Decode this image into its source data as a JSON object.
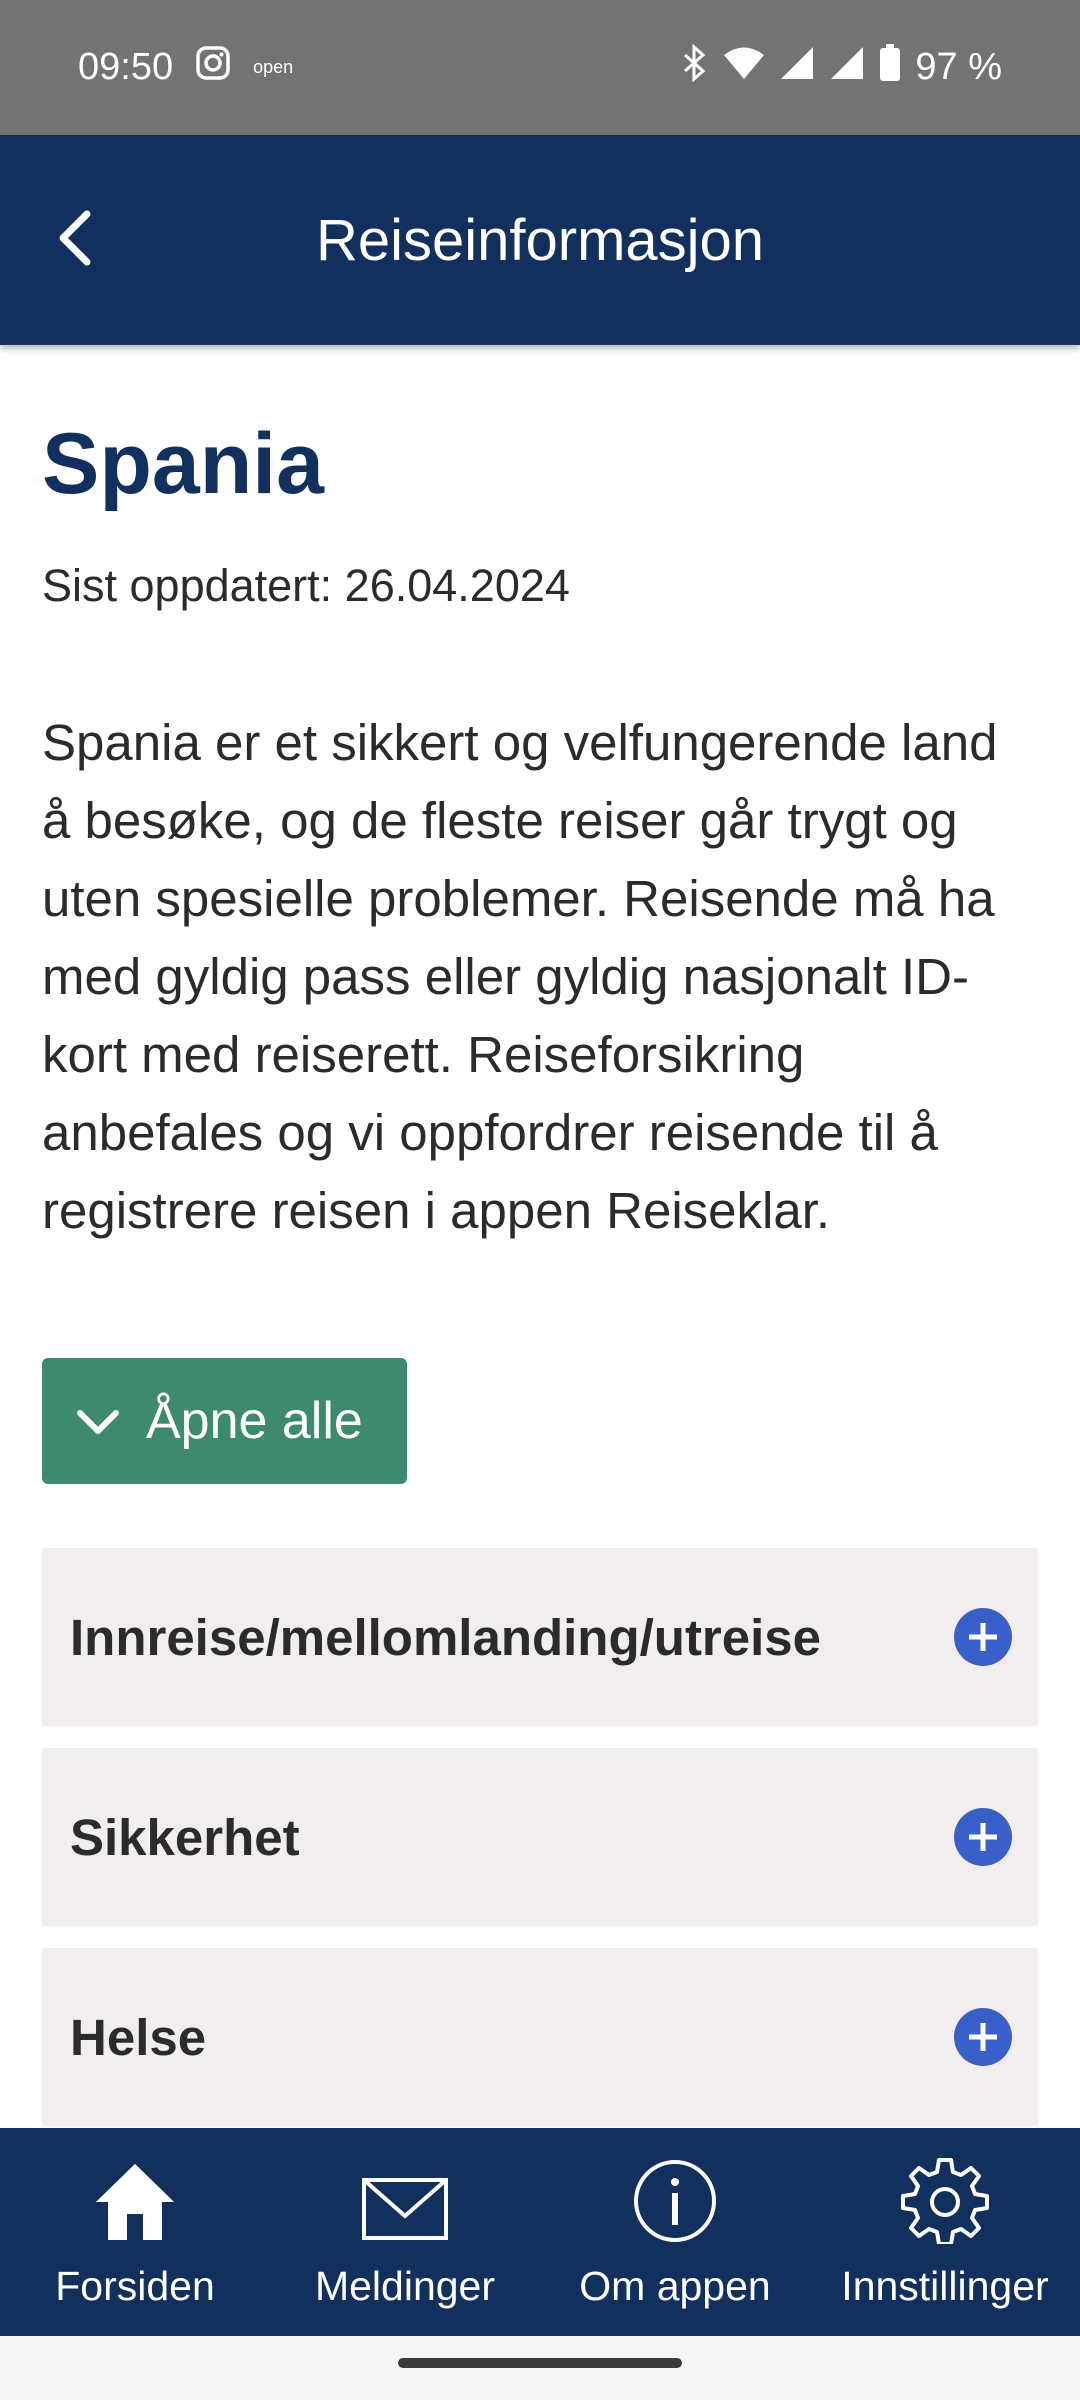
{
  "status_bar": {
    "time": "09:50",
    "open_label": "open",
    "battery": "97 %",
    "icons": [
      "instagram-icon",
      "bluetooth-icon",
      "wifi-icon",
      "signal-icon",
      "signal-icon",
      "battery-icon"
    ]
  },
  "header": {
    "title": "Reiseinformasjon",
    "back_icon": "back-arrow-icon"
  },
  "main": {
    "country": "Spania",
    "updated": "Sist oppdatert: 26.04.2024",
    "intro": "Spania er et sikkert og velfungerende land å besøke, og de fleste reiser går trygt og uten spesielle problemer. Reisende må ha med gyldig pass eller gyldig nasjonalt ID-kort med reiserett. Reiseforsikring anbefales og vi oppfordrer reisende til å registrere reisen i appen Reiseklar.",
    "expand_all_label": "Åpne alle",
    "sections": [
      {
        "label": "Innreise/mellomlanding/utreise"
      },
      {
        "label": "Sikkerhet"
      },
      {
        "label": "Helse"
      }
    ]
  },
  "bottom_nav": [
    {
      "label": "Forsiden",
      "icon": "home-icon"
    },
    {
      "label": "Meldinger",
      "icon": "mail-icon"
    },
    {
      "label": "Om appen",
      "icon": "info-icon"
    },
    {
      "label": "Innstillinger",
      "icon": "gear-icon"
    }
  ],
  "colors": {
    "primary": "#12305d",
    "button": "#3d8a6d",
    "accordion_bg": "#f2eeee",
    "plus": "#3b5fc8"
  }
}
